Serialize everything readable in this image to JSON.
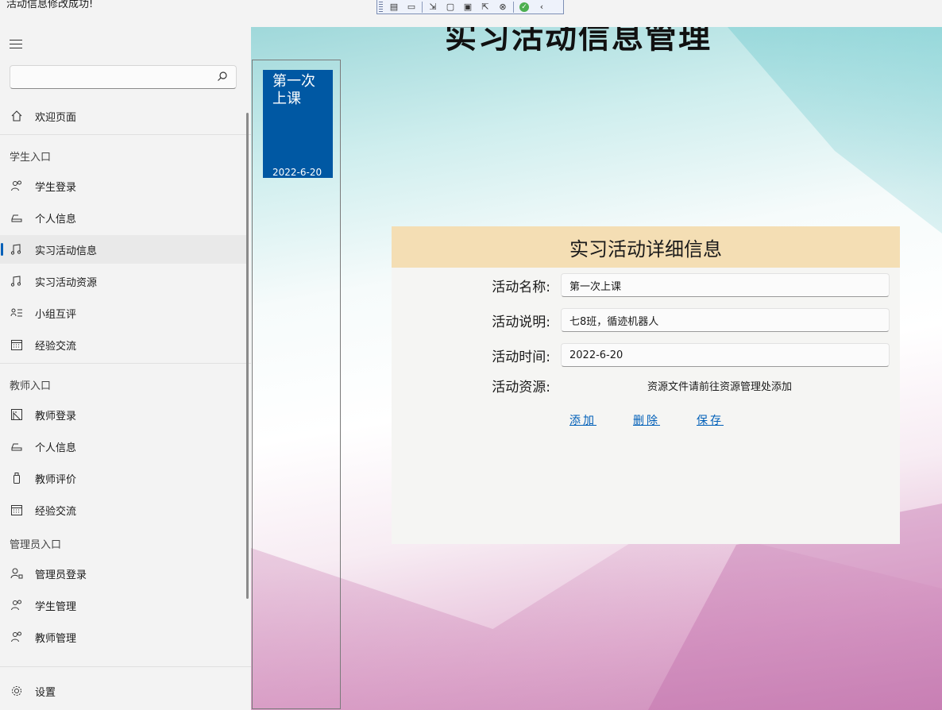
{
  "status_message": "活动信息修改成功!",
  "sidebar": {
    "search": {
      "placeholder": "",
      "value": ""
    },
    "items": [
      {
        "label": "欢迎页面",
        "icon": "home-icon"
      },
      {
        "label": "学生登录",
        "icon": "people-icon"
      },
      {
        "label": "个人信息",
        "icon": "inbox-icon"
      },
      {
        "label": "实习活动信息",
        "icon": "music-note-icon",
        "selected": true
      },
      {
        "label": "实习活动资源",
        "icon": "music-note-icon"
      },
      {
        "label": "小组互评",
        "icon": "contact-list-icon"
      },
      {
        "label": "经验交流",
        "icon": "calendar-icon"
      },
      {
        "label": "教师登录",
        "icon": "ruler-icon"
      },
      {
        "label": "个人信息",
        "icon": "inbox-icon"
      },
      {
        "label": "教师评价",
        "icon": "usb-icon"
      },
      {
        "label": "经验交流",
        "icon": "calendar-icon"
      },
      {
        "label": "管理员登录",
        "icon": "person-key-icon"
      },
      {
        "label": "学生管理",
        "icon": "people-icon"
      },
      {
        "label": "教师管理",
        "icon": "people-icon"
      }
    ],
    "sections": {
      "student": "学生入口",
      "teacher": "教师入口",
      "admin": "管理员入口"
    },
    "settings_label": "设置"
  },
  "main": {
    "page_title": "实习活动信息管理",
    "activity_list": [
      {
        "title": "第一次上课",
        "date": "2022-6-20"
      }
    ],
    "detail": {
      "header": "实习活动详细信息",
      "name_label": "活动名称:",
      "name_value": "第一次上课",
      "desc_label": "活动说明:",
      "desc_value": "七8班，循迹机器人",
      "time_label": "活动时间:",
      "time_value": "2022-6-20",
      "resource_label": "活动资源:",
      "resource_note": "资源文件请前往资源管理处添加",
      "buttons": {
        "add": "添加",
        "delete": "删除",
        "save": "保存"
      }
    }
  },
  "colors": {
    "accent": "#005fb8",
    "card_bg": "#0058a3",
    "detail_header_bg": "#f4deb4"
  }
}
